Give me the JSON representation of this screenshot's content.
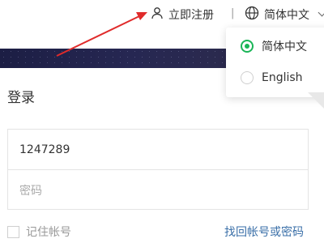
{
  "header": {
    "register_label": "立即注册",
    "separator": "|",
    "language_label": "简体中文"
  },
  "language_menu": {
    "options": [
      {
        "label": "简体中文",
        "selected": true
      },
      {
        "label": "English",
        "selected": false
      }
    ],
    "accent_color": "#1ab557"
  },
  "annotation": {
    "arrow_color": "#e02b2b"
  },
  "login": {
    "title": "登录",
    "account_value": "1247289",
    "password_placeholder": "密码",
    "remember_label": "记住帐号",
    "forgot_label": "找回帐号或密码"
  },
  "icons": {
    "register": "user-icon",
    "language": "globe-icon",
    "dropdown": "chevron-down-icon"
  }
}
